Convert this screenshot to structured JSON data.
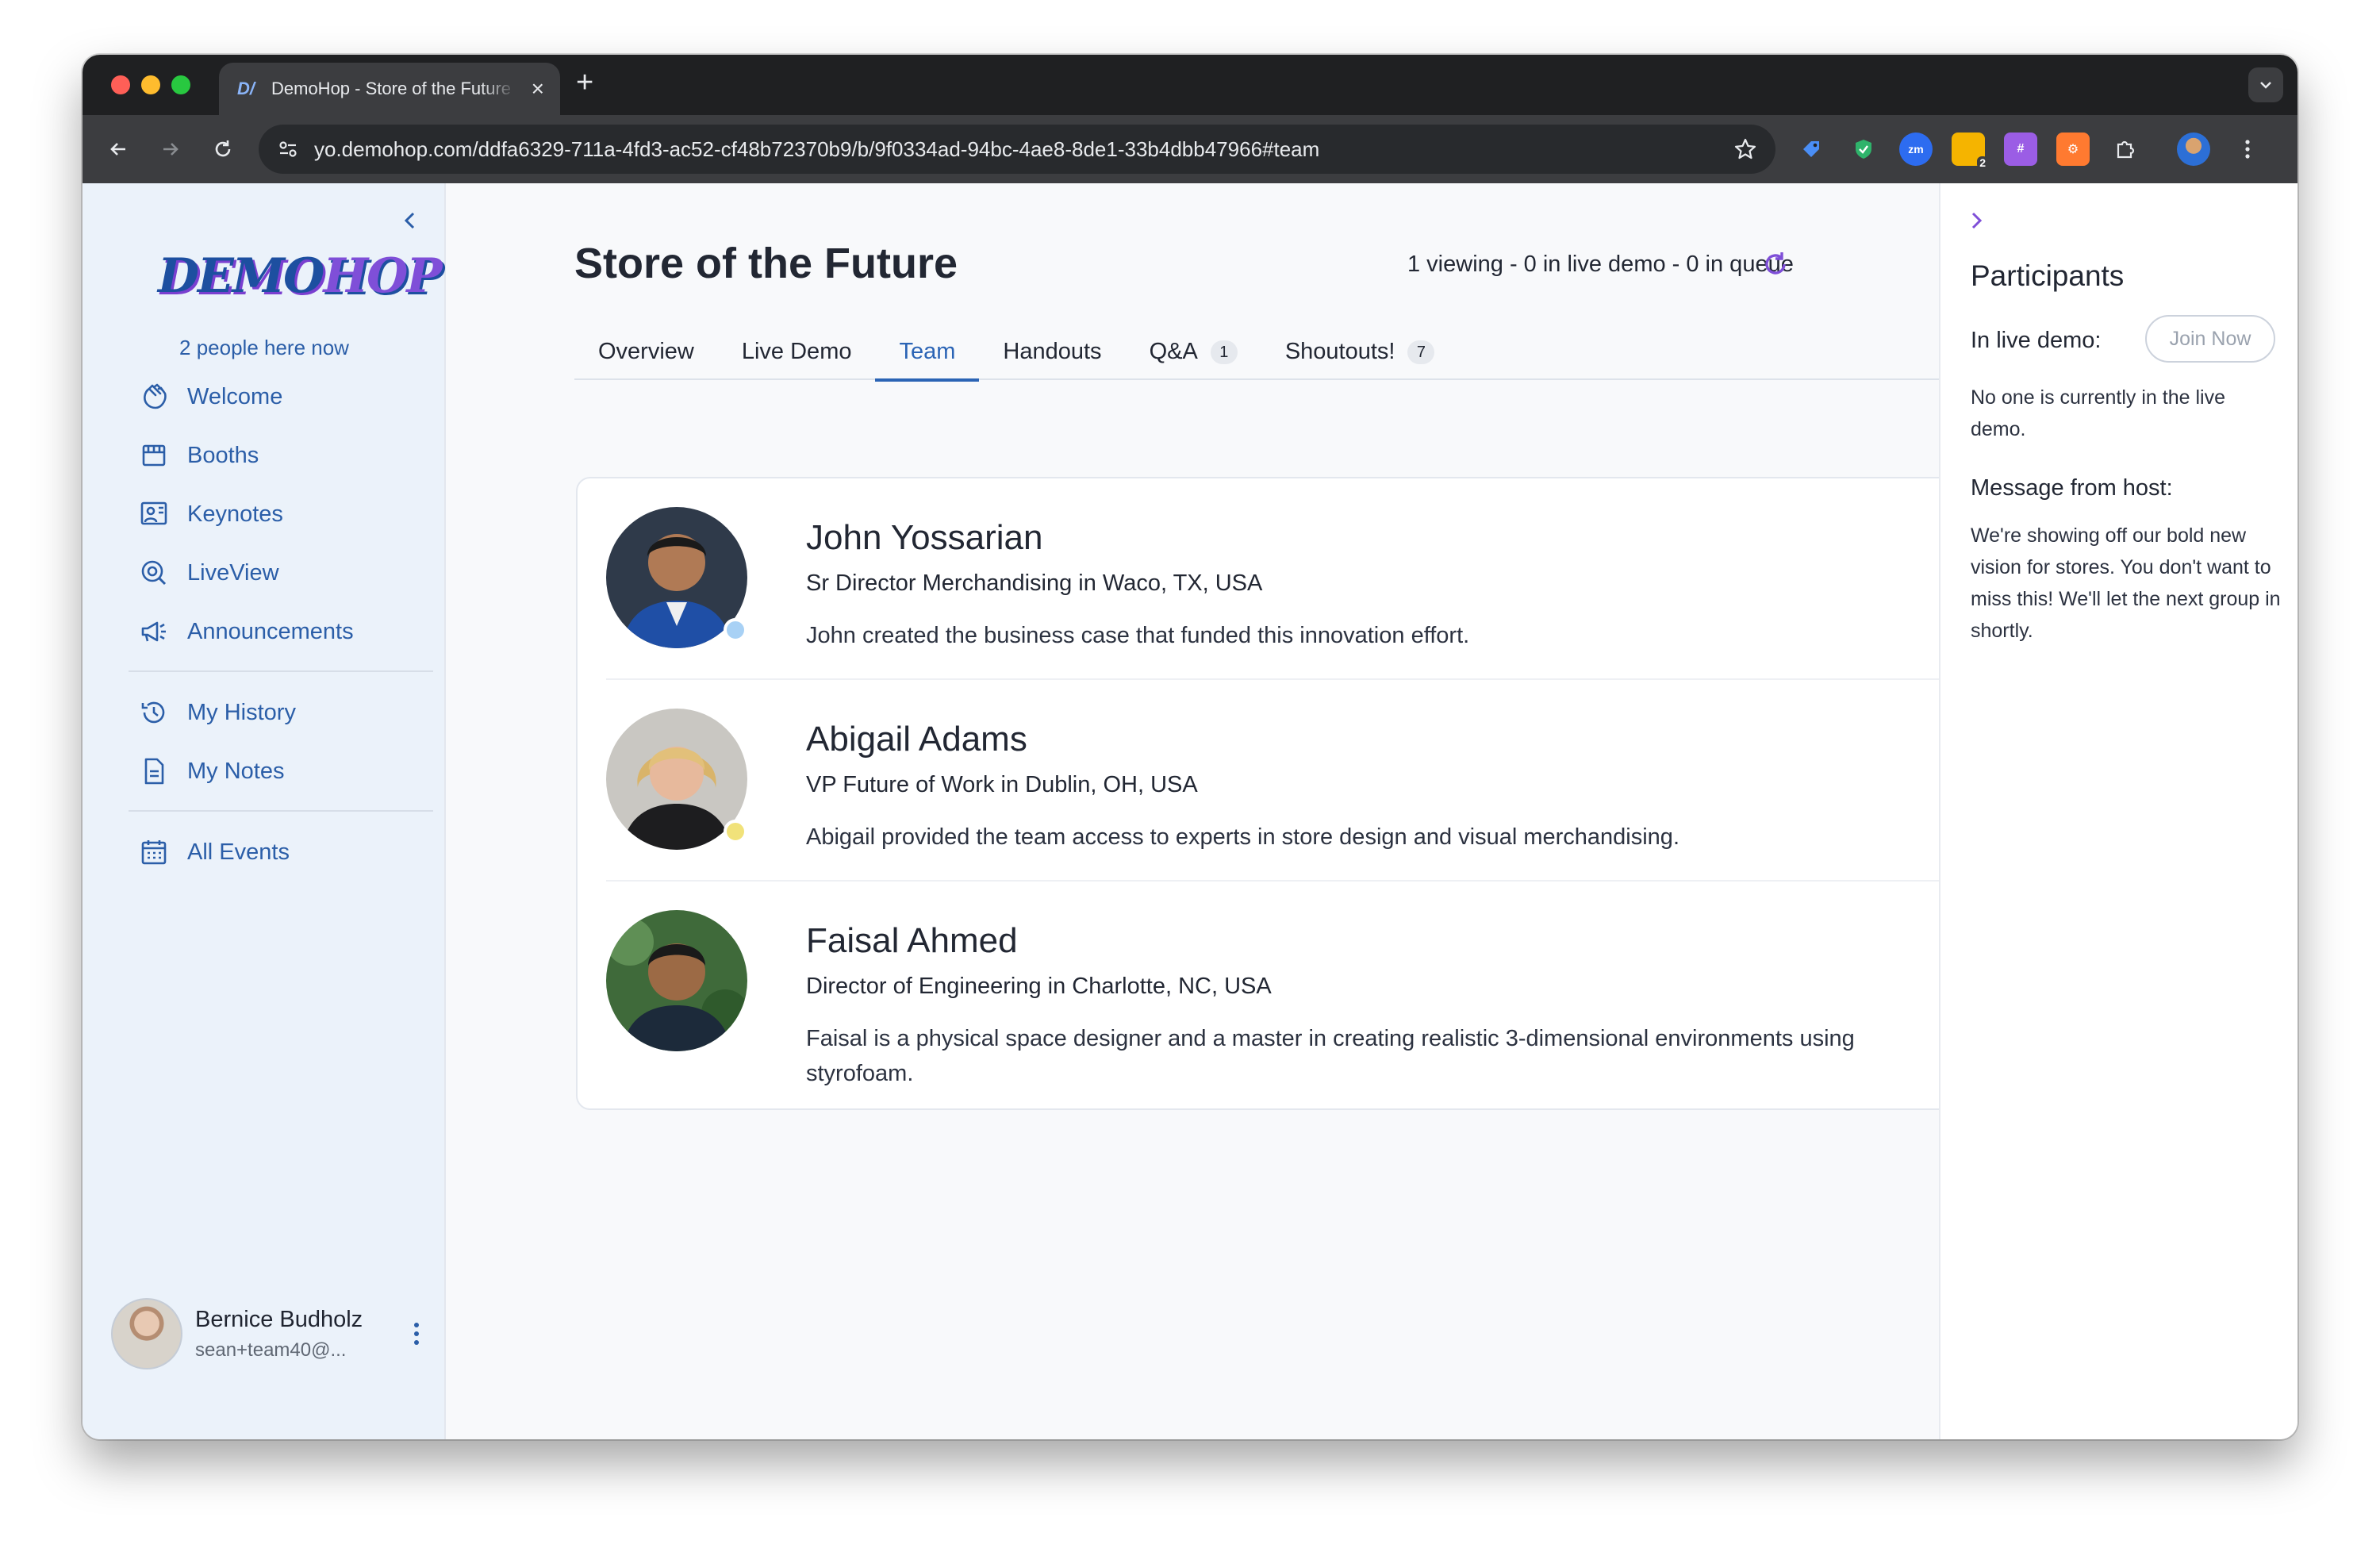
{
  "browser": {
    "tab_title": "DemoHop - Store of the Future",
    "url": "yo.demohop.com/ddfa6329-711a-4fd3-ac52-cf48b72370b9/b/9f0334ad-94bc-4ae8-8de1-33b4dbb47966#team",
    "extensions": [
      {
        "icon": "tag-extension-icon",
        "color": "#3b82f6"
      },
      {
        "icon": "shield-extension-icon",
        "color": "#22c55e"
      },
      {
        "icon": "zoom-extension-icon",
        "color": "#2563eb",
        "label": "zm"
      },
      {
        "icon": "folder-extension-icon",
        "color": "#f5b400",
        "label": "2"
      },
      {
        "icon": "grid-extension-icon",
        "color": "#9b5de5"
      },
      {
        "icon": "hubspot-extension-icon",
        "color": "#ff7a30"
      },
      {
        "icon": "puzzle-extension-icon",
        "color": "#e8eaed"
      }
    ]
  },
  "sidebar": {
    "logo_demo": "DEMO",
    "logo_hop": "HOP",
    "people_now": "2 people here now",
    "nav_primary": [
      {
        "label": "Welcome",
        "icon": "wave-hand-icon"
      },
      {
        "label": "Booths",
        "icon": "storefront-icon"
      },
      {
        "label": "Keynotes",
        "icon": "presenter-icon"
      },
      {
        "label": "LiveView",
        "icon": "live-search-icon"
      },
      {
        "label": "Announcements",
        "icon": "megaphone-icon"
      }
    ],
    "nav_secondary": [
      {
        "label": "My History",
        "icon": "history-icon"
      },
      {
        "label": "My Notes",
        "icon": "notes-icon"
      }
    ],
    "nav_tertiary": [
      {
        "label": "All Events",
        "icon": "calendar-icon"
      }
    ],
    "user": {
      "name": "Bernice Budholz",
      "email": "sean+team40@..."
    }
  },
  "main": {
    "title": "Store of the Future",
    "status": "1 viewing - 0 in live demo - 0 in queue",
    "tabs": [
      {
        "label": "Overview"
      },
      {
        "label": "Live Demo"
      },
      {
        "label": "Team",
        "active": true
      },
      {
        "label": "Handouts"
      },
      {
        "label": "Q&A",
        "badge": "1"
      },
      {
        "label": "Shoutouts!",
        "badge": "7"
      }
    ],
    "team": [
      {
        "name": "John Yossarian",
        "title": "Sr Director Merchandising",
        "location_prefix": " in Waco, TX, USA",
        "description": "John created the business case that funded this innovation effort.",
        "status_color": "#a8d1f5"
      },
      {
        "name": "Abigail Adams",
        "title": "VP Future of Work",
        "location_prefix": " in Dublin, OH, USA",
        "description": "Abigail provided the team access to experts in store design and visual merchandising.",
        "status_color": "#f1e27a"
      },
      {
        "name": "Faisal Ahmed",
        "title": "Director of Engineering",
        "location_prefix": " in Charlotte, NC, USA",
        "description": "Faisal is a physical space designer and a master in creating realistic 3-dimensional environments using styrofoam."
      }
    ]
  },
  "participants": {
    "title": "Participants",
    "in_live_demo_label": "In live demo:",
    "join_button": "Join Now",
    "nobody_text": "No one is currently in the live demo.",
    "message_title": "Message from host:",
    "message_body": "We're showing off our bold new vision for stores. You don't want to miss this!  We'll let the next group in shortly."
  },
  "colors": {
    "accent": "#2b64b5",
    "sidebar_bg": "#ebf2fa",
    "nav_text": "#2b5ea8"
  }
}
